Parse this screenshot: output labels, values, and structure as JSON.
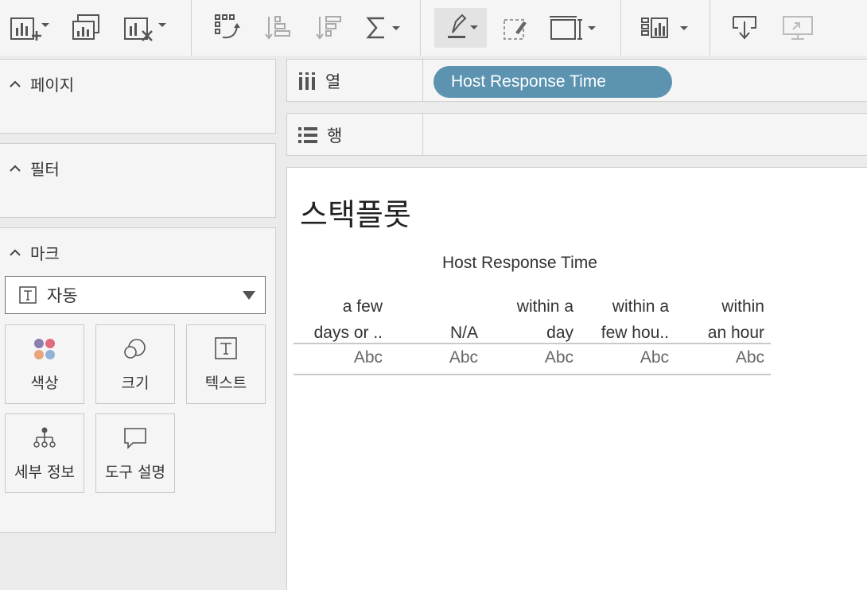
{
  "toolbar": {
    "buttons": [
      {
        "name": "new-worksheet",
        "icon": "add-chart-icon"
      },
      {
        "name": "duplicate-sheet",
        "icon": "duplicate-chart-icon"
      },
      {
        "name": "clear-sheet",
        "icon": "clear-chart-icon"
      },
      {
        "name": "swap-rows-columns",
        "icon": "swap-icon"
      },
      {
        "name": "sort-ascending",
        "icon": "sort-ascending-icon"
      },
      {
        "name": "sort-descending",
        "icon": "sort-descending-icon"
      },
      {
        "name": "totals",
        "icon": "sigma-icon"
      },
      {
        "name": "highlight",
        "icon": "highlighter-icon"
      },
      {
        "name": "group-members",
        "icon": "lasso-icon"
      },
      {
        "name": "fit",
        "icon": "fit-width-icon"
      },
      {
        "name": "show-me",
        "icon": "show-me-icon"
      },
      {
        "name": "download",
        "icon": "download-icon"
      },
      {
        "name": "presentation-mode",
        "icon": "presentation-icon"
      }
    ]
  },
  "panels": {
    "pages": {
      "title": "페이지"
    },
    "filters": {
      "title": "필터"
    },
    "marks": {
      "title": "마크",
      "mark_type": "자동",
      "cards": {
        "color": "색상",
        "size": "크기",
        "text": "텍스트",
        "detail": "세부 정보",
        "tooltip": "도구 설명"
      }
    }
  },
  "shelves": {
    "columns": {
      "label": "열",
      "pill": "Host Response Time"
    },
    "rows": {
      "label": "행"
    }
  },
  "view": {
    "title": "스택플롯",
    "column_header": "Host Response Time",
    "columns": [
      {
        "line1": "a few",
        "line2": "days or ..",
        "value": "Abc"
      },
      {
        "line1": "",
        "line2": "N/A",
        "value": "Abc"
      },
      {
        "line1": "within a",
        "line2": "day",
        "value": "Abc"
      },
      {
        "line1": "within a",
        "line2": "few hou..",
        "value": "Abc"
      },
      {
        "line1": "within",
        "line2": "an hour",
        "value": "Abc"
      }
    ]
  },
  "colors": {
    "pill": "#5b93b0",
    "legend_dots": [
      "#8e7bb0",
      "#e06b7d",
      "#e8a47b",
      "#8fb3d6"
    ]
  }
}
